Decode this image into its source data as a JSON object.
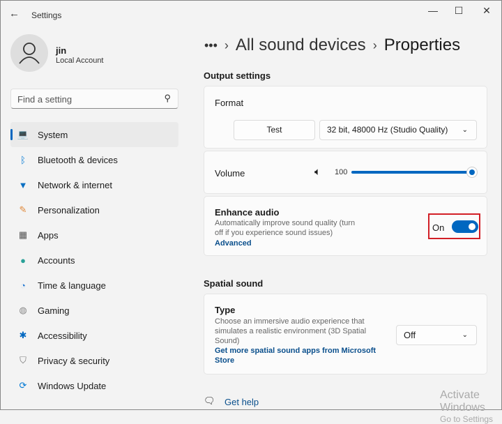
{
  "window": {
    "title": "Settings",
    "back": "←",
    "minimize": "—",
    "maximize": "☐",
    "close": "✕"
  },
  "user": {
    "name": "jin",
    "type": "Local Account"
  },
  "search": {
    "placeholder": "Find a setting"
  },
  "nav": [
    {
      "label": "System",
      "icon": "💻"
    },
    {
      "label": "Bluetooth & devices",
      "icon": "ᛒ"
    },
    {
      "label": "Network & internet",
      "icon": "▼"
    },
    {
      "label": "Personalization",
      "icon": "✎"
    },
    {
      "label": "Apps",
      "icon": "▦"
    },
    {
      "label": "Accounts",
      "icon": "●"
    },
    {
      "label": "Time & language",
      "icon": "◔"
    },
    {
      "label": "Gaming",
      "icon": "◍"
    },
    {
      "label": "Accessibility",
      "icon": "✱"
    },
    {
      "label": "Privacy & security",
      "icon": "⛉"
    },
    {
      "label": "Windows Update",
      "icon": "⟳"
    }
  ],
  "breadcrumb": {
    "more": "•••",
    "parent": "All sound devices",
    "current": "Properties"
  },
  "output": {
    "heading": "Output settings",
    "format_label": "Format",
    "test_button": "Test",
    "format_value": "32 bit, 48000 Hz (Studio Quality)",
    "volume_label": "Volume",
    "volume_value": "100",
    "volume_fraction": 1.0,
    "enhance_title": "Enhance audio",
    "enhance_desc_1": "Automatically improve sound quality (turn",
    "enhance_desc_2": "off if you experience sound issues)",
    "advanced_link": "Advanced",
    "toggle_state": "On"
  },
  "spatial": {
    "heading": "Spatial sound",
    "type_title": "Type",
    "desc_1": "Choose an immersive audio experience that",
    "desc_2": "simulates a realistic environment (3D Spatial",
    "desc_3": "Sound)",
    "link_1": "Get more spatial sound apps from Microsoft",
    "link_2": "Store",
    "value": "Off"
  },
  "help": {
    "label": "Get help"
  },
  "watermark": {
    "line1": "Activate Windows",
    "line2": "Go to Settings"
  },
  "colors": {
    "accent": "#0067c0",
    "highlight": "#d21f26"
  }
}
